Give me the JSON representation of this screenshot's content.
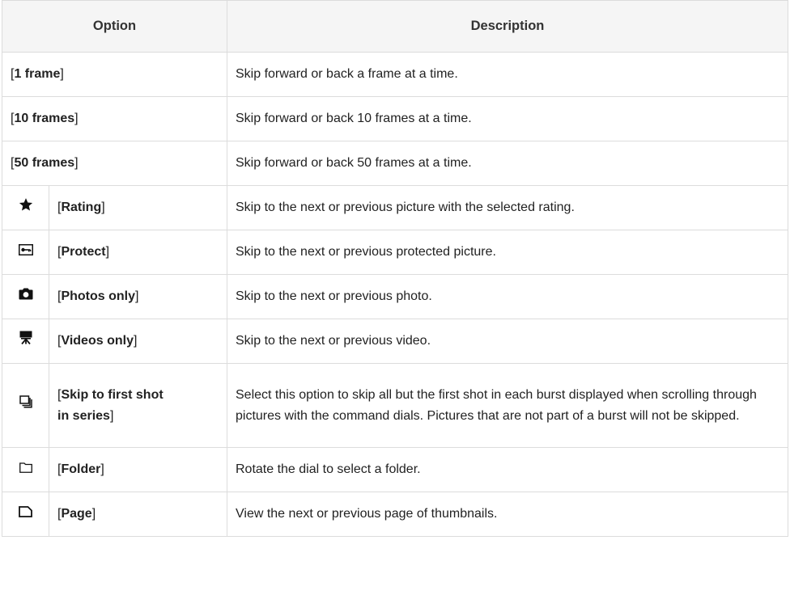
{
  "header": {
    "option": "Option",
    "description": "Description"
  },
  "rows": [
    {
      "name": "1 frame",
      "desc": "Skip forward or back a frame at a time."
    },
    {
      "name": "10 frames",
      "desc": "Skip forward or back 10 frames at a time."
    },
    {
      "name": "50 frames",
      "desc": "Skip forward or back 50 frames at a time."
    },
    {
      "icon": "star-icon",
      "name": "Rating",
      "desc": "Skip to the next or previous picture with the selected rating."
    },
    {
      "icon": "protect-key-icon",
      "name": "Protect",
      "desc": "Skip to the next or previous protected picture."
    },
    {
      "icon": "camera-icon",
      "name": "Photos only",
      "desc": "Skip to the next or previous photo."
    },
    {
      "icon": "movie-camera-icon",
      "name": "Videos only",
      "desc": "Skip to the next or previous video."
    },
    {
      "icon": "burst-stack-icon",
      "name1": "Skip to first shot",
      "name2": "in series",
      "desc": "Select this option to skip all but the first shot in each burst displayed when scrolling through pictures with the command dials. Pictures that are not part of a burst will not be skipped."
    },
    {
      "icon": "folder-icon",
      "name": "Folder",
      "desc": "Rotate the dial to select a folder."
    },
    {
      "icon": "page-icon",
      "name": "Page",
      "desc": "View the next or previous page of thumbnails."
    }
  ]
}
